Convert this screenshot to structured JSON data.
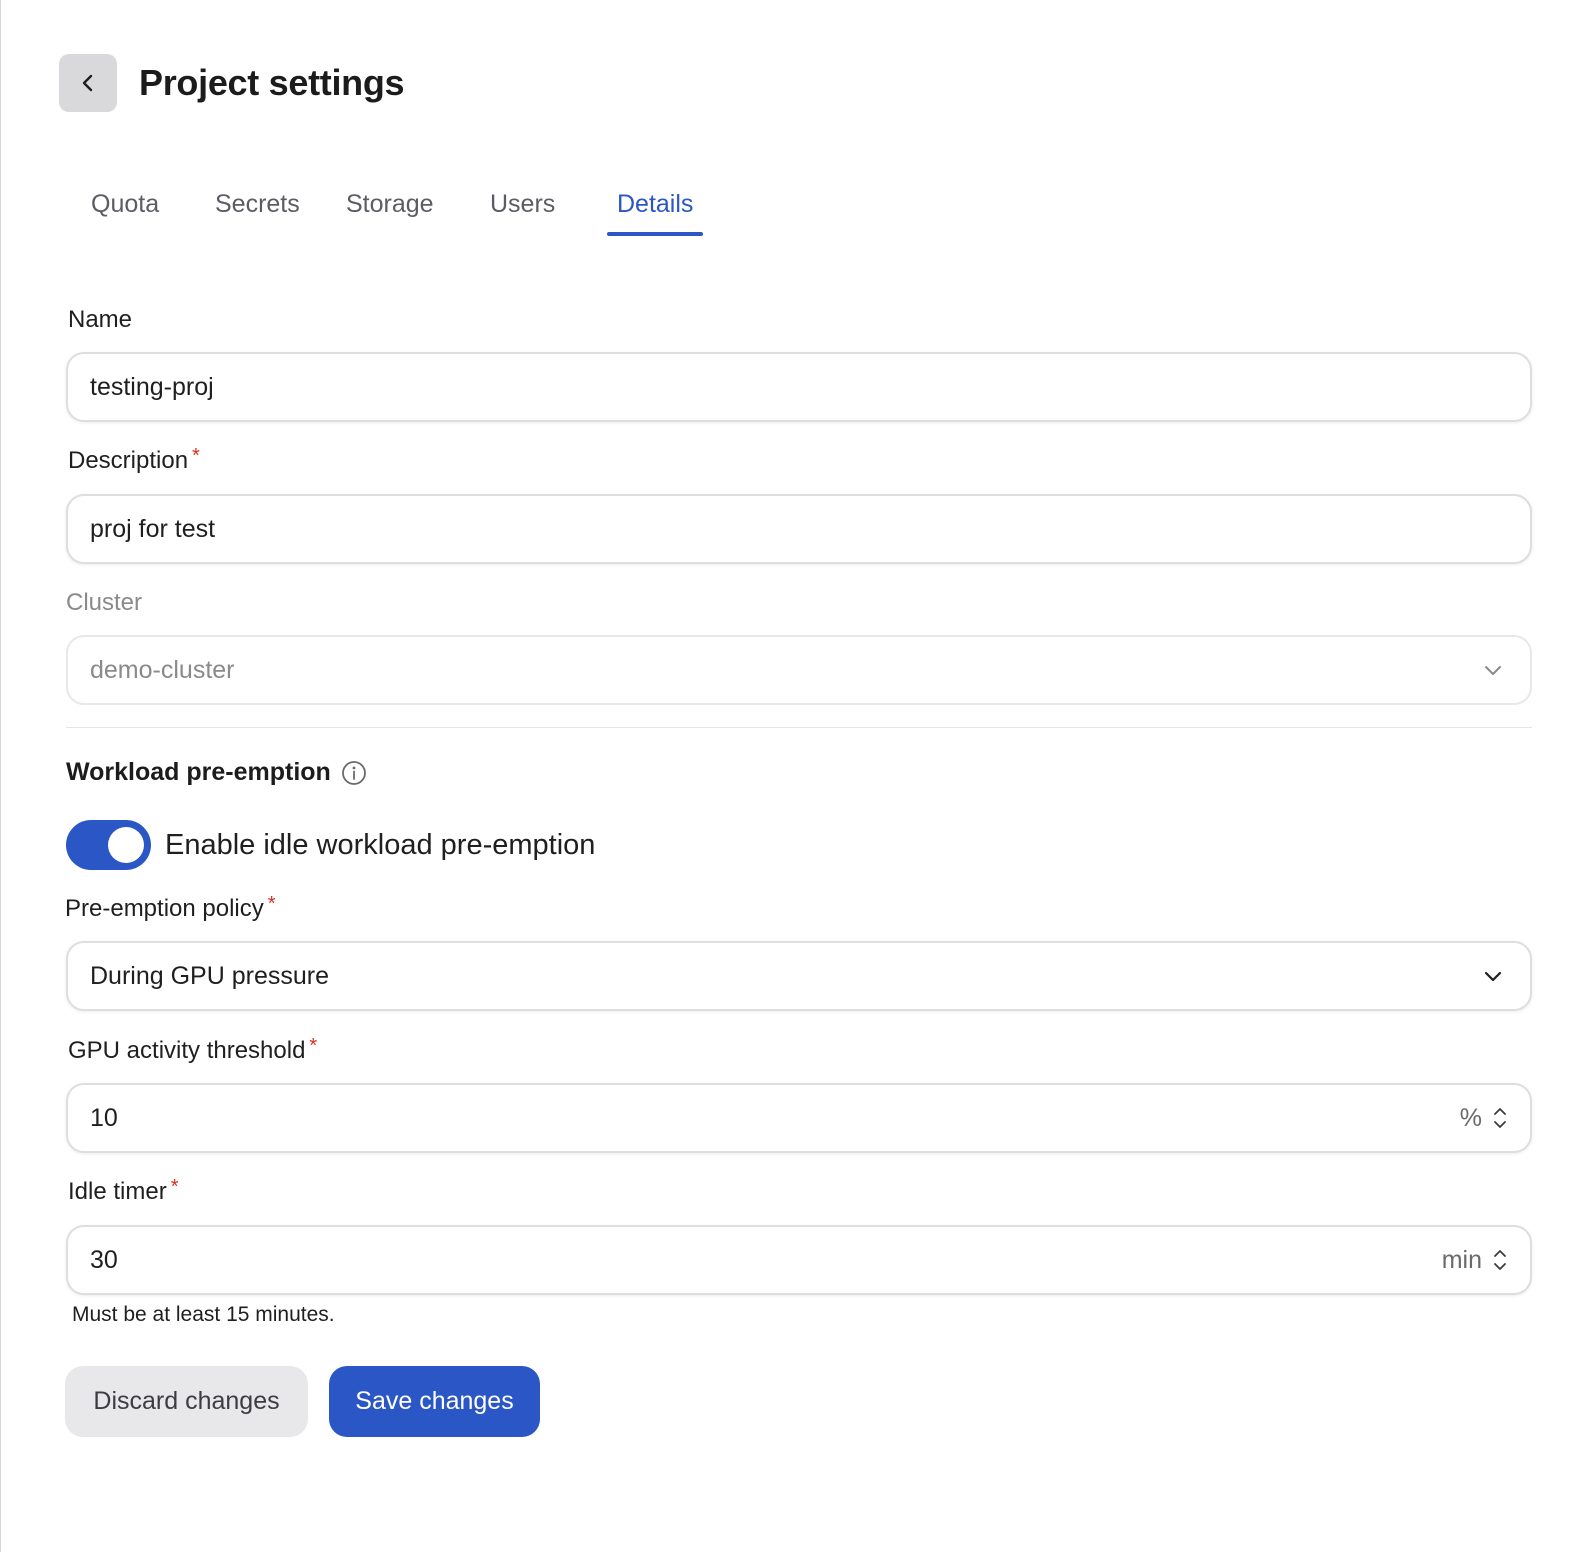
{
  "header": {
    "title": "Project settings",
    "back_icon": "chevron-left-icon"
  },
  "tabs": [
    {
      "label": "Quota",
      "active": false
    },
    {
      "label": "Secrets",
      "active": false
    },
    {
      "label": "Storage",
      "active": false
    },
    {
      "label": "Users",
      "active": false
    },
    {
      "label": "Details",
      "active": true
    }
  ],
  "form": {
    "name": {
      "label": "Name",
      "value": "testing-proj"
    },
    "description": {
      "label": "Description",
      "required_mark": "*",
      "value": "proj for test"
    },
    "cluster": {
      "label": "Cluster",
      "value": "demo-cluster",
      "disabled": true
    }
  },
  "preemption": {
    "section_title": "Workload pre-emption",
    "info_icon": "info-icon",
    "toggle": {
      "label": "Enable idle workload pre-emption",
      "on": true
    },
    "policy": {
      "label": "Pre-emption policy",
      "required_mark": "*",
      "value": "During GPU pressure"
    },
    "threshold": {
      "label": "GPU activity threshold",
      "required_mark": "*",
      "value": "10",
      "unit": "%"
    },
    "idle_timer": {
      "label": "Idle timer",
      "required_mark": "*",
      "value": "30",
      "unit": "min",
      "helper": "Must be at least 15 minutes."
    }
  },
  "actions": {
    "discard_label": "Discard changes",
    "save_label": "Save changes"
  },
  "colors": {
    "accent": "#2a56c6",
    "required": "#d92d20"
  }
}
